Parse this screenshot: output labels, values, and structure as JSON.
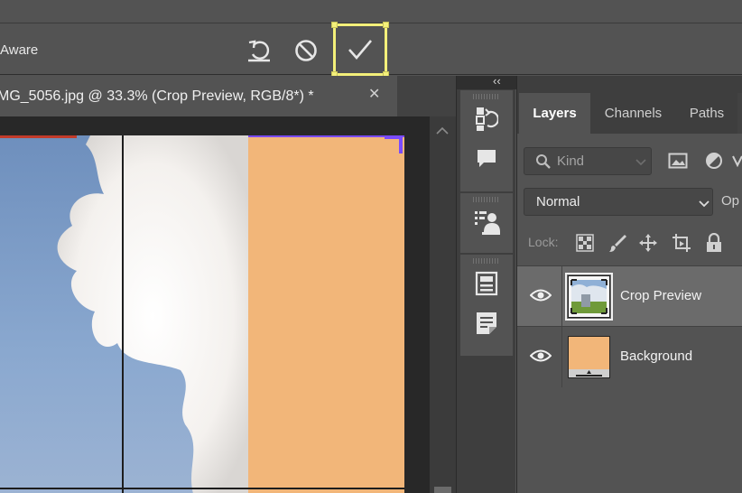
{
  "options_bar": {
    "content_aware_label": "Aware",
    "reset_tooltip_icon": "reset-icon",
    "cancel_icon": "cancel-icon",
    "commit_icon": "checkmark-icon"
  },
  "document": {
    "tab_title": "MG_5056.jpg @ 33.3% (Crop Preview, RGB/8*) *",
    "close_glyph": "✕"
  },
  "colors": {
    "accent_highlight": "#f4f07a",
    "crop_handle": "#7a4bff",
    "background_fill": "#f2b679",
    "panel_bg": "#535353"
  },
  "panel_strip": {
    "collapse_glyph": "‹‹",
    "icons": [
      "history-icon",
      "comments-icon",
      "properties-icon",
      "libraries-icon",
      "notes-icon"
    ]
  },
  "layers_panel": {
    "tabs": [
      {
        "label": "Layers",
        "active": true
      },
      {
        "label": "Channels",
        "active": false
      },
      {
        "label": "Paths",
        "active": false
      }
    ],
    "filter": {
      "placeholder": "Kind"
    },
    "blend_mode": "Normal",
    "opacity_label": "Op",
    "lock_label": "Lock:",
    "layers": [
      {
        "name": "Crop Preview",
        "visible": true,
        "selected": true
      },
      {
        "name": "Background",
        "visible": true,
        "selected": false
      }
    ]
  }
}
